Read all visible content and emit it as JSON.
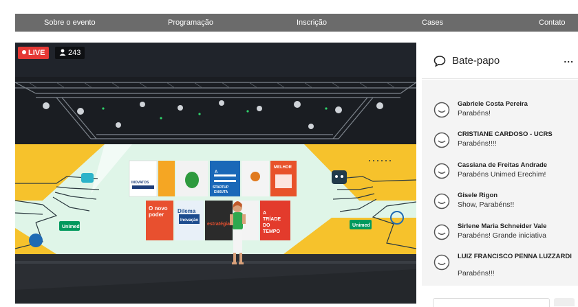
{
  "nav": {
    "items": [
      {
        "label": "Sobre o evento"
      },
      {
        "label": "Programação"
      },
      {
        "label": "Inscrição"
      },
      {
        "label": "Cases"
      },
      {
        "label": "Contato"
      }
    ]
  },
  "video": {
    "live_label": "LIVE",
    "viewer_count": "243",
    "stage_books": [
      {
        "title": "INOVATOS"
      },
      {
        "title": "A STARTUP ENXUTA"
      },
      {
        "title": "MELHOR"
      },
      {
        "title": "O novo poder"
      },
      {
        "title": "Dilema da Inovação"
      },
      {
        "title": "estratégia"
      },
      {
        "title": "A TRÍADE DO TEMPO"
      }
    ],
    "sponsor_logo": "Unimed"
  },
  "chat": {
    "title": "Bate-papo",
    "menu_label": "...",
    "messages": [
      {
        "name": "Gabriele Costa Pereira",
        "text": "Parabéns!"
      },
      {
        "name": "CRISTIANE CARDOSO - UCRS",
        "text": "Parabéns!!!!"
      },
      {
        "name": "Cassiana de Freitas Andrade",
        "text": "Parabéns Unimed Erechim!"
      },
      {
        "name": "Gisele Rigon",
        "text": "Show, Parabéns!!"
      },
      {
        "name": "Sirlene Maria Schneider Vale",
        "text": "Parabéns! Grande iniciativa"
      },
      {
        "name": "LUIZ FRANCISCO PENNA LUZZARDI",
        "text": "Parabéns!!!"
      }
    ]
  },
  "colors": {
    "nav_bg": "#6b6b6b",
    "live_red": "#e53935",
    "stage_yellow": "#f6c22c",
    "stage_mint": "#dff5e8",
    "chat_list_bg": "#f4f4f4"
  }
}
